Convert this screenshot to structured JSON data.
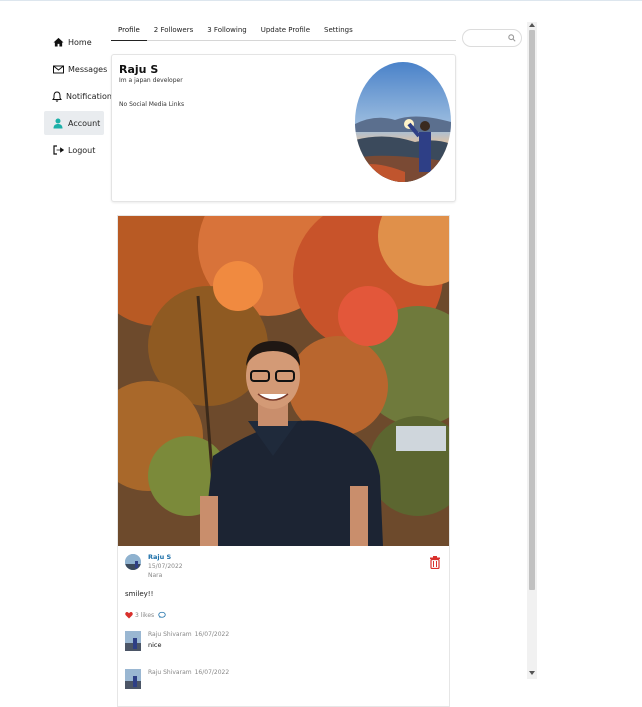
{
  "sidebar": {
    "items": [
      {
        "label": "Home",
        "icon": "home-icon"
      },
      {
        "label": "Messages",
        "icon": "envelope-icon"
      },
      {
        "label": "Notifications",
        "icon": "bell-icon"
      },
      {
        "label": "Account",
        "icon": "user-icon",
        "active": true
      },
      {
        "label": "Logout",
        "icon": "logout-icon"
      }
    ]
  },
  "tabs": [
    {
      "label": "Profile",
      "active": true
    },
    {
      "label": "2 Followers"
    },
    {
      "label": "3 Following"
    },
    {
      "label": "Update Profile"
    },
    {
      "label": "Settings"
    }
  ],
  "profile": {
    "name": "Raju S",
    "bio": "Im a japan developer",
    "social": "No Social Media Links"
  },
  "post": {
    "author": "Raju S",
    "date": "15/07/2022",
    "location": "Nara",
    "caption": "smiley!!",
    "likes": "3 likes"
  },
  "comments": [
    {
      "name": "Raju Shivaram",
      "date": "16/07/2022",
      "text": "nice"
    },
    {
      "name": "Raju Shivaram",
      "date": "16/07/2022",
      "text": ""
    }
  ],
  "search": {
    "placeholder": ""
  },
  "colors": {
    "accent": "#1cb0a8",
    "link": "#1a6ea8",
    "delete": "#d9302c",
    "like": "#d9302c"
  }
}
